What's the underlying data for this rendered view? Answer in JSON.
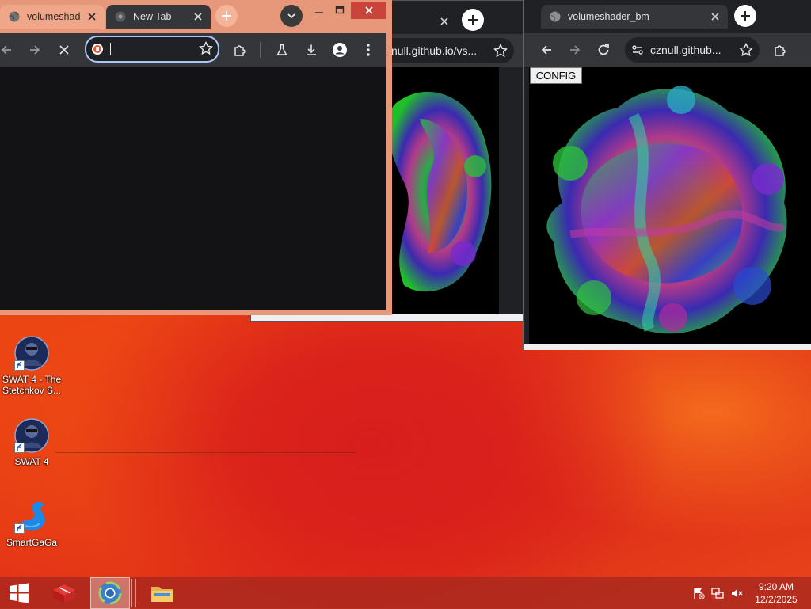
{
  "windows": {
    "back": {
      "url_text": "znull.github.io/vs..."
    },
    "right": {
      "tab_title": "volumeshader_bm",
      "url_text": "cznull.github...",
      "config_label": "CONFIG"
    },
    "front": {
      "tabs": [
        {
          "title": "volumeshad",
          "favicon": "globe-icon"
        },
        {
          "title": "New Tab",
          "favicon": "chrome-icon"
        }
      ],
      "address_value": ""
    }
  },
  "desktop": {
    "icons": [
      {
        "label": "SWAT 4 - The Stetchkov S...",
        "icon": "swat-icon"
      },
      {
        "label": "SWAT 4",
        "icon": "swat-icon"
      },
      {
        "label": "SmartGaGa",
        "icon": "swan-icon"
      }
    ]
  },
  "taskbar": {
    "time": "9:20 AM",
    "date": "12/2/2025"
  },
  "colors": {
    "chrome_dark": "#202124",
    "chrome_toolbar": "#35363a",
    "front_frame": "#e8987a",
    "desktop_orange": "#f2561a",
    "desktop_red": "#d81e1c"
  }
}
